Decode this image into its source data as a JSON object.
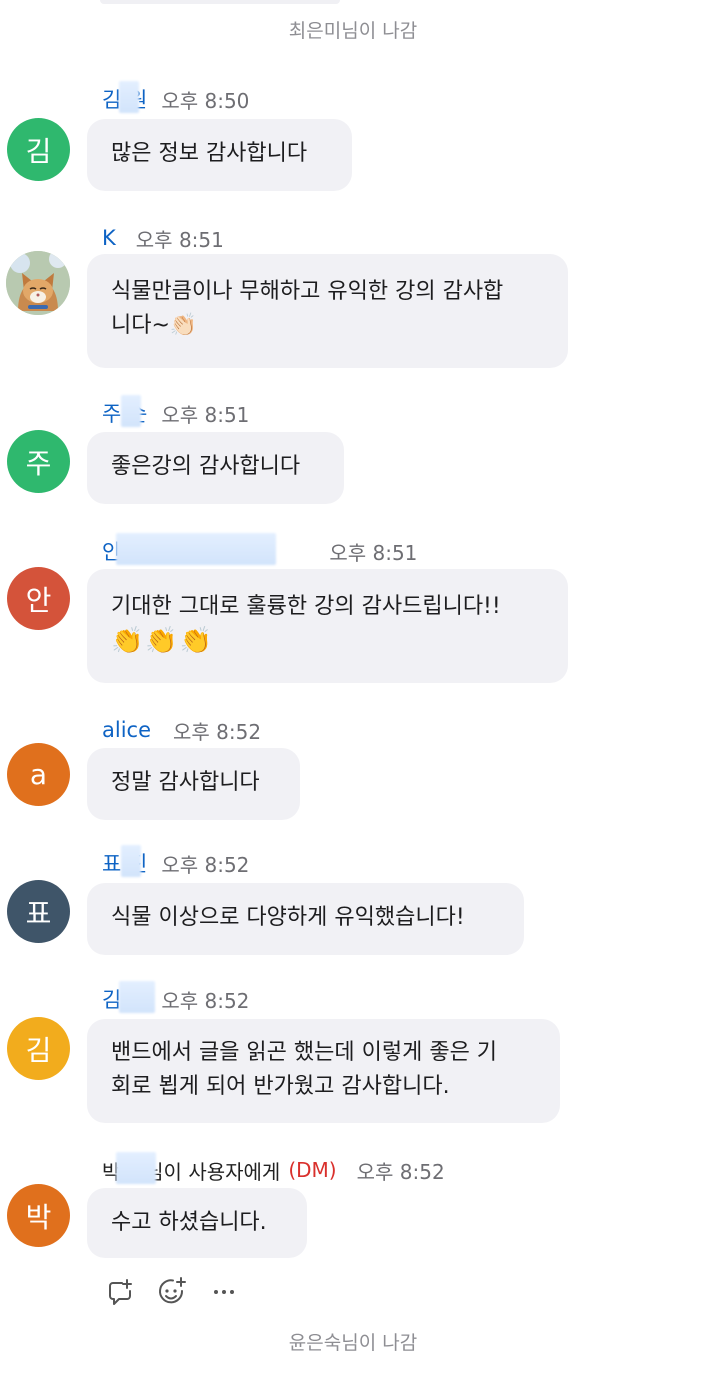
{
  "system_top": "최은미님이 나감",
  "system_bottom": "윤은숙님이 나감",
  "messages": [
    {
      "avatar_text": "김",
      "name": "김 원",
      "time": "오후 8:50",
      "lines": [
        "많은 정보 감사합니다"
      ]
    },
    {
      "avatar_text": "",
      "name": "K",
      "time": "오후 8:51",
      "lines": [
        "식물만큼이나 무해하고 유익한 강의 감사합",
        "니다~👏🏻"
      ]
    },
    {
      "avatar_text": "주",
      "name": "주 순",
      "time": "오후 8:51",
      "lines": [
        "좋은강의 감사합니다"
      ]
    },
    {
      "avatar_text": "안",
      "name": "안 관",
      "time": "오후 8:51",
      "lines": [
        "기대한 그대로 훌륭한 강의 감사드립니다!!",
        "👏👏👏"
      ]
    },
    {
      "avatar_text": "a",
      "name": "alice",
      "time": "오후 8:52",
      "lines": [
        "정말 감사합니다"
      ]
    },
    {
      "avatar_text": "표",
      "name": "표 진",
      "time": "오후 8:52",
      "lines": [
        "식물 이상으로 다양하게 유익했습니다!"
      ]
    },
    {
      "avatar_text": "김",
      "name": "김 주",
      "time": "오후 8:52",
      "lines": [
        "밴드에서 글을 읽곤 했는데 이렇게 좋은 기",
        "회로 뵙게 되어 반가웠고 감사합니다."
      ]
    },
    {
      "avatar_text": "박",
      "name": "박 숙님이 사용자에게",
      "dm": "(DM)",
      "time": "오후 8:52",
      "lines": [
        "수고 하셨습니다."
      ]
    }
  ],
  "colors": {
    "avatar_green": "#2fb86e",
    "avatar_red": "#d4533a",
    "avatar_orange": "#e0701d",
    "avatar_slate": "#3f5569",
    "avatar_yellow": "#f2ac1d",
    "name_blue": "#0e63c4",
    "dm_red": "#d9302c",
    "bubble_bg": "#f1f1f5"
  },
  "icons": [
    "reply-icon",
    "add-reaction-icon",
    "more-options-icon"
  ]
}
